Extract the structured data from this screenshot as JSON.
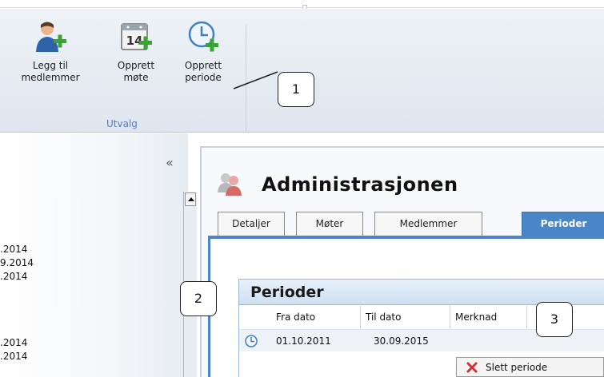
{
  "ribbon": {
    "buttons": [
      {
        "label": "Legg til\nmedlemmer",
        "icon": "add-member-icon"
      },
      {
        "label": "Opprett\nmøte",
        "icon": "calendar-add-icon"
      },
      {
        "label": "Opprett\nperiode",
        "icon": "clock-add-icon"
      }
    ],
    "calendar_day": "14",
    "group_label": "Utvalg"
  },
  "callouts": [
    "1",
    "2",
    "3"
  ],
  "left_panel": {
    "collapse_glyph": "«",
    "date_fragments": [
      ".2014",
      "9.2014",
      ".2014",
      ".2014",
      ".2014"
    ]
  },
  "main": {
    "title": "Administrasjonen",
    "tabs": [
      {
        "label": "Detaljer",
        "active": false
      },
      {
        "label": "Møter",
        "active": false
      },
      {
        "label": "Medlemmer",
        "active": false
      },
      {
        "label": "Perioder",
        "active": true
      }
    ],
    "perioder": {
      "heading": "Perioder",
      "columns": [
        "Fra dato",
        "Til dato",
        "Merknad"
      ],
      "rows": [
        {
          "fra": "01.10.2011",
          "til": "30.09.2015",
          "merknad": ""
        }
      ]
    }
  },
  "context_menu": {
    "items": [
      {
        "label": "Slett periode",
        "icon": "delete-x-icon"
      }
    ]
  },
  "colors": {
    "accent": "#4a86c6",
    "ribbon_group": "#5a7ab2",
    "add_green": "#3aa335",
    "delete_red": "#d03030"
  }
}
